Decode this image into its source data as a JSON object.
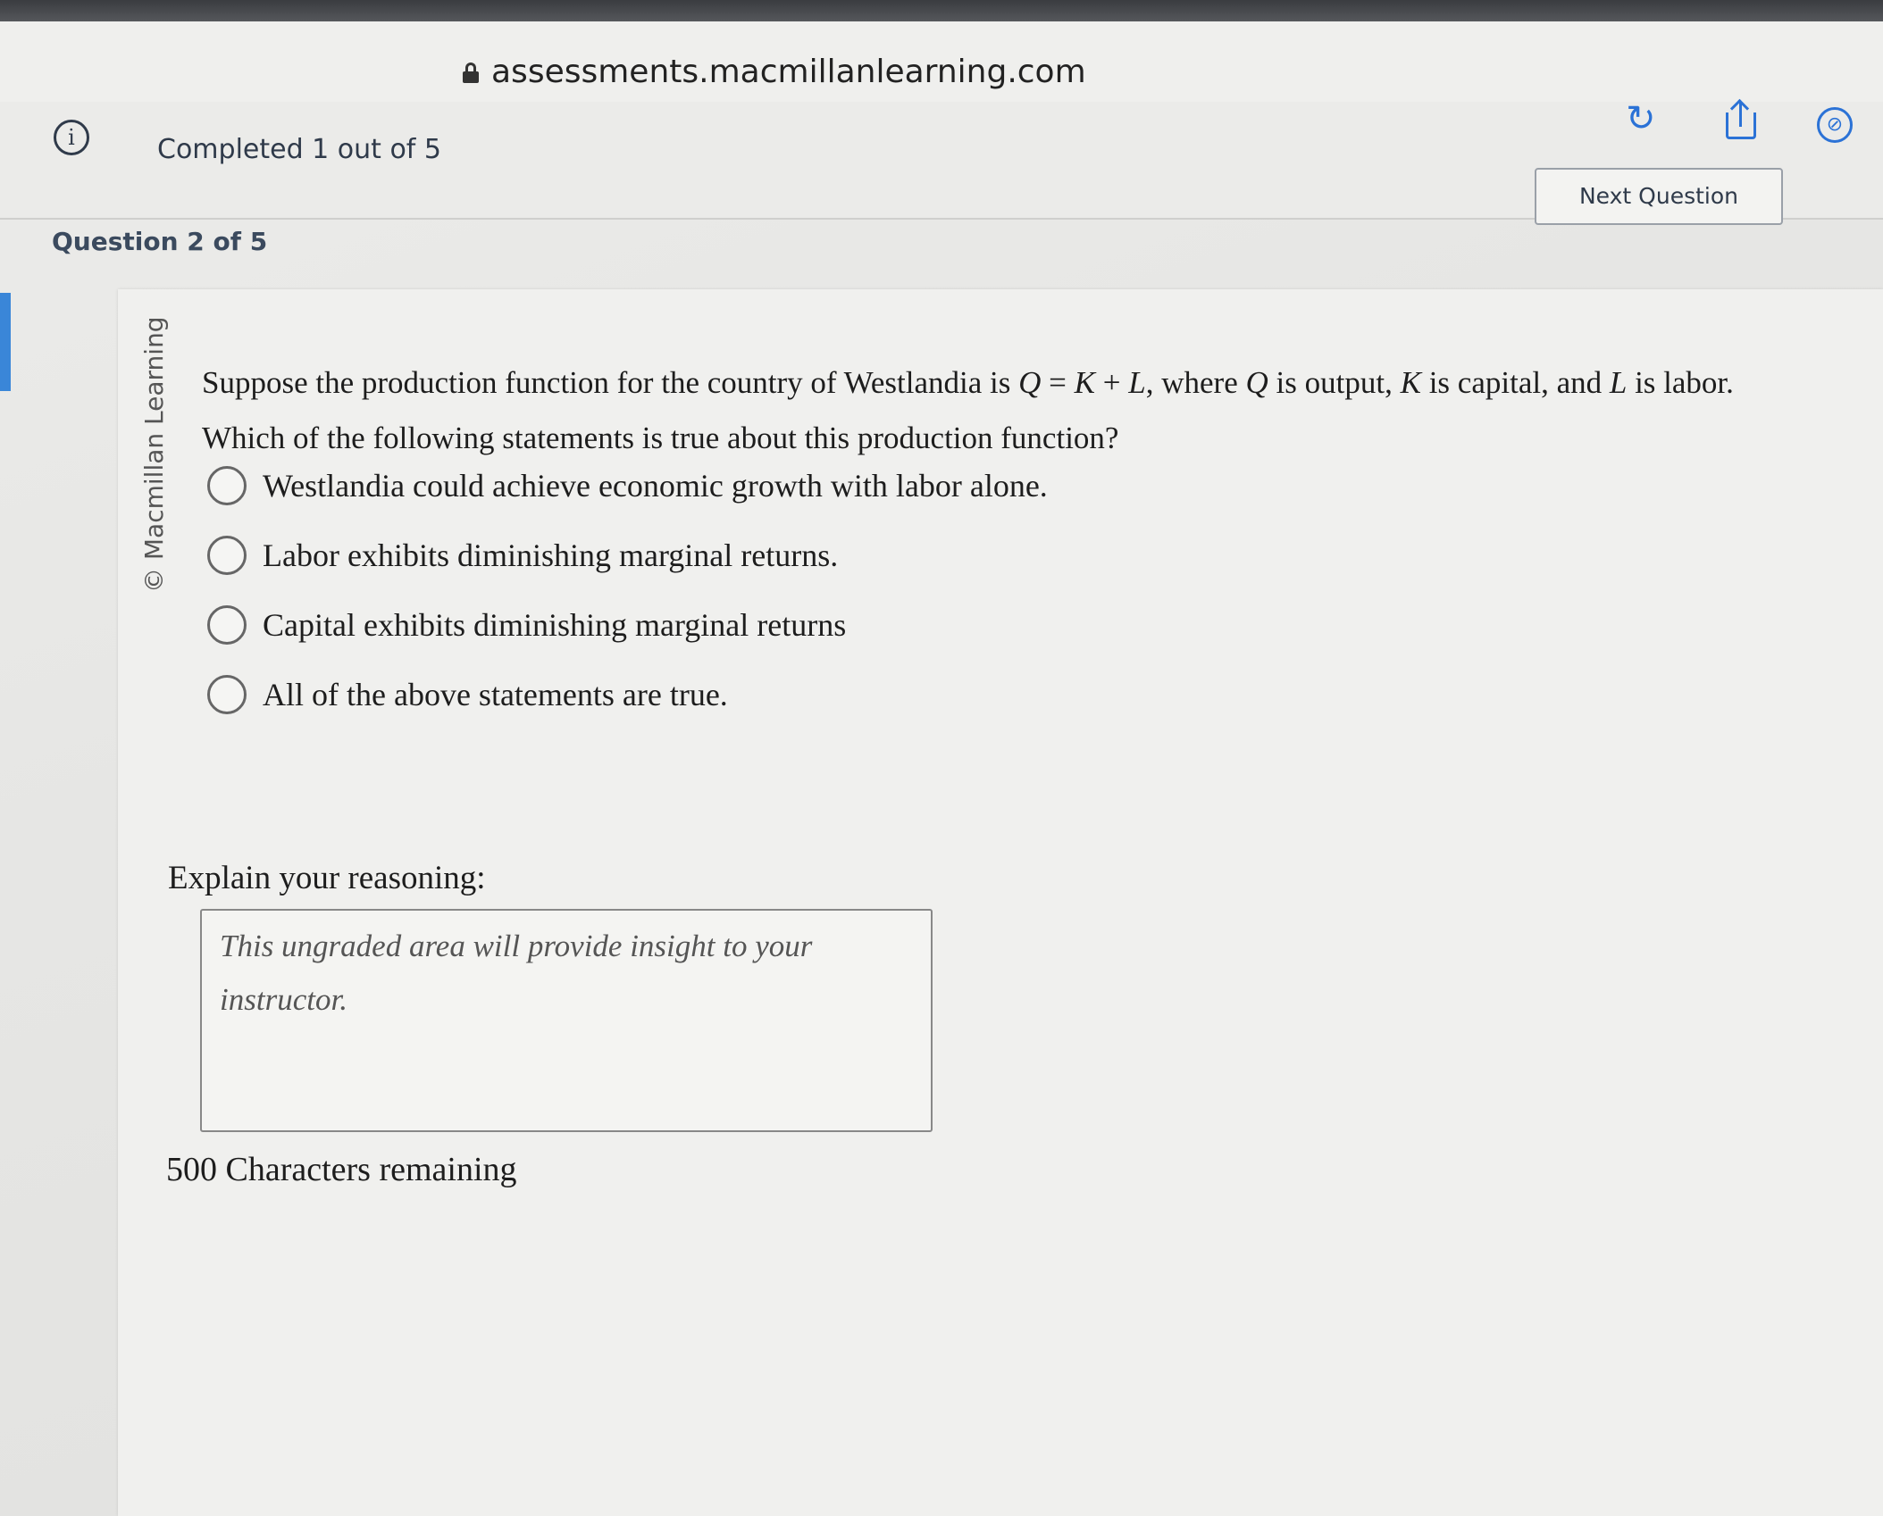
{
  "browser": {
    "url": "assessments.macmillanlearning.com"
  },
  "header": {
    "progress_text": "Completed 1 out of 5",
    "next_button_label": "Next Question"
  },
  "question": {
    "number_label": "Question 2 of 5",
    "copyright": "© Macmillan Learning",
    "prompt_part1": "Suppose the production function for the country of Westlandia is ",
    "formula_Q": "Q",
    "formula_eq": " = ",
    "formula_K": "K",
    "formula_plus": " + ",
    "formula_L": "L",
    "prompt_part2": ", where ",
    "var_Q": "Q",
    "prompt_part3": " is output, ",
    "var_K": "K",
    "prompt_part4": " is capital, and ",
    "var_L": "L",
    "prompt_part5": " is labor. Which of the following statements is true about this production function?",
    "options": [
      "Westlandia could achieve economic growth with labor alone.",
      "Labor exhibits diminishing marginal returns.",
      "Capital exhibits diminishing marginal returns",
      "All of the above statements are true."
    ]
  },
  "reasoning": {
    "label": "Explain your reasoning:",
    "placeholder": "This ungraded area will provide insight to your instructor.",
    "value": "",
    "chars_remaining": "500 Characters remaining"
  },
  "icons": {
    "lock": "lock-icon",
    "info": "info-icon",
    "refresh": "refresh-icon",
    "share": "share-icon",
    "compass": "compass-icon"
  },
  "colors": {
    "accent": "#2b72d6",
    "heading": "#3b4a5e",
    "tab": "#3a86d8"
  }
}
